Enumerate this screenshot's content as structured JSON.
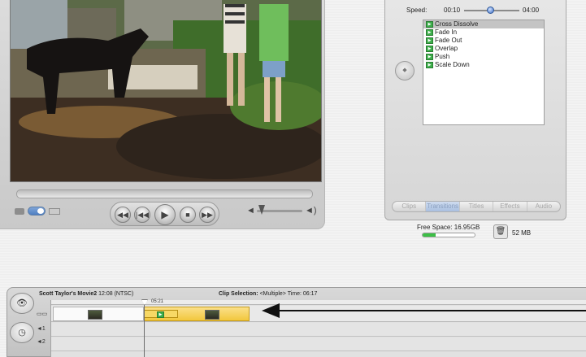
{
  "monitor": {
    "transport_buttons": [
      "◀◀",
      "|◀◀",
      "▶",
      "■",
      "▶▶"
    ]
  },
  "transitions_panel": {
    "speed_label": "Speed:",
    "speed_min": "00:10",
    "speed_max": "04:00",
    "items": [
      {
        "label": "Cross Dissolve",
        "selected": true
      },
      {
        "label": "Fade In",
        "selected": false
      },
      {
        "label": "Fade Out",
        "selected": false
      },
      {
        "label": "Overlap",
        "selected": false
      },
      {
        "label": "Push",
        "selected": false
      },
      {
        "label": "Scale Down",
        "selected": false
      }
    ],
    "tabs": [
      {
        "label": "Clips",
        "active": false
      },
      {
        "label": "Transitions",
        "active": true
      },
      {
        "label": "Titles",
        "active": false
      },
      {
        "label": "Effects",
        "active": false
      },
      {
        "label": "Audio",
        "active": false
      }
    ]
  },
  "status": {
    "free_space": "Free Space: 16.95GB",
    "free_space_fill_fraction": 0.25,
    "project_size": "52 MB",
    "accent_color": "#3cbf46"
  },
  "timeline": {
    "project_title": "Scott Taylor's Movie2",
    "project_duration": "12:08 (NTSC)",
    "clip_selection_label": "Clip Selection:",
    "clip_selection_value": "<Multiple>",
    "time_label": "Time:",
    "time_value": "06:17",
    "playhead_time": "05:21",
    "clip_color": "#f2c73d",
    "track_labels": [
      "◄1",
      "◄2"
    ]
  }
}
